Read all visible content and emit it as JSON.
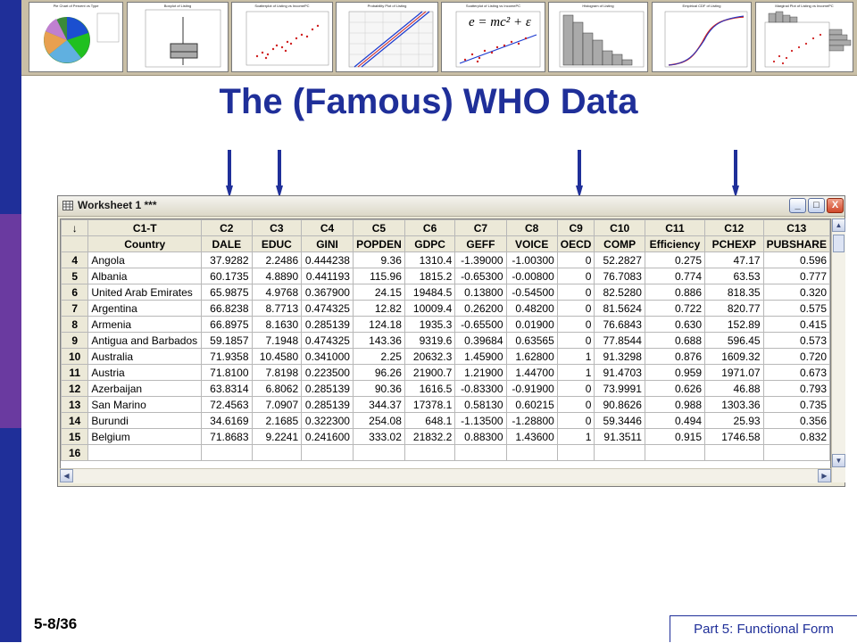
{
  "slide": {
    "title": "The (Famous) WHO Data",
    "number": "5-8/36",
    "footer": "Part 5: Functional Form"
  },
  "thumbnails": [
    {
      "title": "Pie Chart of Percent vs Type"
    },
    {
      "title": "Boxplot of Listing"
    },
    {
      "title": "Scatterplot of Listing vs IncomePC"
    },
    {
      "title": "Probability Plot of Listing"
    },
    {
      "title": "Scatterplot of Listing vs IncomePC",
      "formula": "e = mc² + ε"
    },
    {
      "title": "Histogram of Listing"
    },
    {
      "title": "Empirical CDF of Listing"
    },
    {
      "title": "Marginal Plot of Listing vs IncomePC"
    }
  ],
  "worksheet": {
    "title": "Worksheet 1 ***",
    "buttons": {
      "minimize": "_",
      "maximize": "□",
      "close": "X"
    },
    "corner": "↓",
    "column_ids": [
      "C1-T",
      "C2",
      "C3",
      "C4",
      "C5",
      "C6",
      "C7",
      "C8",
      "C9",
      "C10",
      "C11",
      "C12",
      "C13"
    ],
    "column_names": [
      "Country",
      "DALE",
      "EDUC",
      "GINI",
      "POPDEN",
      "GDPC",
      "GEFF",
      "VOICE",
      "OECD",
      "COMP",
      "Efficiency",
      "PCHEXP",
      "PUBSHARE"
    ],
    "rows": [
      {
        "n": "4",
        "c": [
          "Angola",
          "37.9282",
          "2.2486",
          "0.444238",
          "9.36",
          "1310.4",
          "-1.39000",
          "-1.00300",
          "0",
          "52.2827",
          "0.275",
          "47.17",
          "0.596"
        ]
      },
      {
        "n": "5",
        "c": [
          "Albania",
          "60.1735",
          "4.8890",
          "0.441193",
          "115.96",
          "1815.2",
          "-0.65300",
          "-0.00800",
          "0",
          "76.7083",
          "0.774",
          "63.53",
          "0.777"
        ]
      },
      {
        "n": "6",
        "c": [
          "United Arab Emirates",
          "65.9875",
          "4.9768",
          "0.367900",
          "24.15",
          "19484.5",
          "0.13800",
          "-0.54500",
          "0",
          "82.5280",
          "0.886",
          "818.35",
          "0.320"
        ]
      },
      {
        "n": "7",
        "c": [
          "Argentina",
          "66.8238",
          "8.7713",
          "0.474325",
          "12.82",
          "10009.4",
          "0.26200",
          "0.48200",
          "0",
          "81.5624",
          "0.722",
          "820.77",
          "0.575"
        ]
      },
      {
        "n": "8",
        "c": [
          "Armenia",
          "66.8975",
          "8.1630",
          "0.285139",
          "124.18",
          "1935.3",
          "-0.65500",
          "0.01900",
          "0",
          "76.6843",
          "0.630",
          "152.89",
          "0.415"
        ]
      },
      {
        "n": "9",
        "c": [
          "Antigua and Barbados",
          "59.1857",
          "7.1948",
          "0.474325",
          "143.36",
          "9319.6",
          "0.39684",
          "0.63565",
          "0",
          "77.8544",
          "0.688",
          "596.45",
          "0.573"
        ]
      },
      {
        "n": "10",
        "c": [
          "Australia",
          "71.9358",
          "10.4580",
          "0.341000",
          "2.25",
          "20632.3",
          "1.45900",
          "1.62800",
          "1",
          "91.3298",
          "0.876",
          "1609.32",
          "0.720"
        ]
      },
      {
        "n": "11",
        "c": [
          "Austria",
          "71.8100",
          "7.8198",
          "0.223500",
          "96.26",
          "21900.7",
          "1.21900",
          "1.44700",
          "1",
          "91.4703",
          "0.959",
          "1971.07",
          "0.673"
        ]
      },
      {
        "n": "12",
        "c": [
          "Azerbaijan",
          "63.8314",
          "6.8062",
          "0.285139",
          "90.36",
          "1616.5",
          "-0.83300",
          "-0.91900",
          "0",
          "73.9991",
          "0.626",
          "46.88",
          "0.793"
        ]
      },
      {
        "n": "13",
        "c": [
          "San Marino",
          "72.4563",
          "7.0907",
          "0.285139",
          "344.37",
          "17378.1",
          "0.58130",
          "0.60215",
          "0",
          "90.8626",
          "0.988",
          "1303.36",
          "0.735"
        ]
      },
      {
        "n": "14",
        "c": [
          "Burundi",
          "34.6169",
          "2.1685",
          "0.322300",
          "254.08",
          "648.1",
          "-1.13500",
          "-1.28800",
          "0",
          "59.3446",
          "0.494",
          "25.93",
          "0.356"
        ]
      },
      {
        "n": "15",
        "c": [
          "Belgium",
          "71.8683",
          "9.2241",
          "0.241600",
          "333.02",
          "21832.2",
          "0.88300",
          "1.43600",
          "1",
          "91.3511",
          "0.915",
          "1746.58",
          "0.832"
        ]
      },
      {
        "n": "16",
        "c": [
          "",
          "",
          "",
          "",
          "",
          "",
          "",
          "",
          "",
          "",
          "",
          "",
          ""
        ]
      }
    ]
  },
  "arrows": {
    "target_columns": [
      "C2",
      "C3",
      "C9",
      "C12"
    ],
    "color": "#1f2f99"
  }
}
